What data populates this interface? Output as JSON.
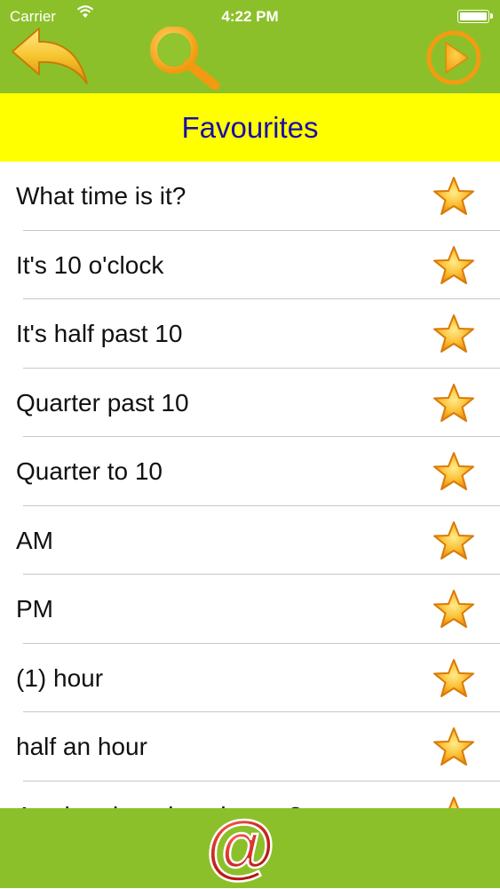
{
  "status_bar": {
    "carrier": "Carrier",
    "time": "4:22 PM"
  },
  "header": {
    "title": "Favourites",
    "icons": {
      "back": "back-arrow-icon",
      "search": "magnifier-icon",
      "play": "play-icon"
    }
  },
  "favourites": [
    {
      "text": "What time is it?"
    },
    {
      "text": "It's 10 o'clock"
    },
    {
      "text": "It's half past 10"
    },
    {
      "text": "Quarter past 10"
    },
    {
      "text": "Quarter to 10"
    },
    {
      "text": "AM"
    },
    {
      "text": "PM"
    },
    {
      "text": "(1) hour"
    },
    {
      "text": "half an hour"
    },
    {
      "text": "At what time does it start?"
    }
  ],
  "footer": {
    "email_icon": "at-sign-icon"
  },
  "colors": {
    "bar_green": "#8cc02a",
    "title_yellow": "#ffff00",
    "title_text": "#1a0fa8",
    "icon_orange": "#f5a81c",
    "email_red": "#cc1010"
  }
}
